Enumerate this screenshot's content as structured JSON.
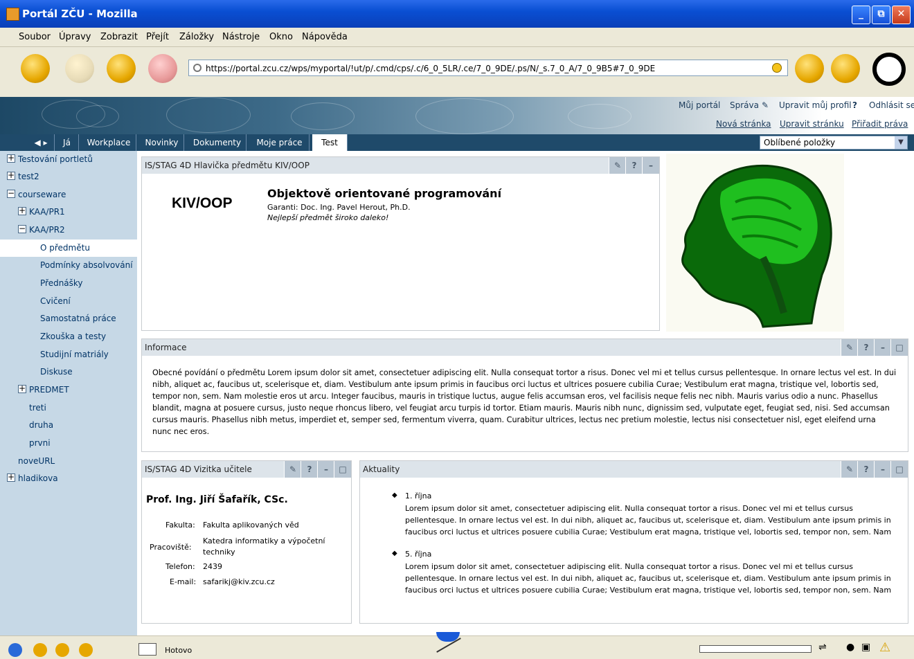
{
  "window": {
    "title": "Portál ZČU - Mozilla",
    "min": "_",
    "max": "⧉",
    "close": "✕"
  },
  "menu": [
    "Soubor",
    "Úpravy",
    "Zobrazit",
    "Přejít",
    "Záložky",
    "Nástroje",
    "Okno",
    "Nápověda"
  ],
  "address": {
    "url": "https://portal.zcu.cz/wps/myportal/!ut/p/.cmd/cps/.c/6_0_5LR/.ce/7_0_9DE/.ps/N/_s.7_0_A/7_0_9B5#7_0_9DE"
  },
  "toplinks": {
    "my_portal": "Můj portál",
    "admin": "Správa",
    "edit_profile": "Upravit můj profil",
    "help": "?",
    "logout": "Odhlásit se",
    "new_page": "Nová stránka",
    "edit_page": "Upravit stránku",
    "assign_rights": "Přiřadit práva"
  },
  "tabs": [
    "Já",
    "Workplace",
    "Novinky",
    "Dokumenty",
    "Moje práce",
    "Test"
  ],
  "favorites": "Oblíbené položky",
  "tree": [
    "Testování portletů",
    "test2",
    "courseware",
    "KAA/PR1",
    "KAA/PR2",
    "O předmětu",
    "Podmínky absolvování",
    "Přednášky",
    "Cvičení",
    "Samostatná práce",
    "Zkouška a testy",
    "Studijní matriály",
    "Diskuse",
    "PREDMET",
    "treti",
    "druha",
    "prvni",
    "noveURL",
    "hladikova"
  ],
  "header_portlet": {
    "title": "IS/STAG 4D Hlavička předmětu KIV/OOP",
    "code": "KIV/OOP",
    "name": "Objektově orientované programování",
    "guarantor": "Garanti: Doc. Ing. Pavel Herout, Ph.D.",
    "motto": "Nejlepší předmět široko daleko!"
  },
  "info_portlet": {
    "title": "Informace",
    "text": "Obecné povídání o předmětu Lorem ipsum dolor sit amet, consectetuer adipiscing elit. Nulla consequat tortor a risus. Donec vel mi et tellus cursus pellentesque. In ornare lectus vel est. In dui nibh, aliquet ac, faucibus ut, scelerisque et, diam. Vestibulum ante ipsum primis in faucibus orci luctus et ultrices posuere cubilia Curae; Vestibulum erat magna, tristique vel, lobortis sed, tempor non, sem. Nam molestie eros ut arcu. Integer faucibus, mauris in tristique luctus, augue felis accumsan eros, vel facilisis neque felis nec nibh. Mauris varius odio a nunc. Phasellus blandit, magna at posuere cursus, justo neque rhoncus libero, vel feugiat arcu turpis id tortor. Etiam mauris. Mauris nibh nunc, dignissim sed, vulputate eget, feugiat sed, nisi. Sed accumsan cursus mauris. Phasellus nibh metus, imperdiet et, semper sed, fermentum viverra, quam. Curabitur ultrices, lectus nec pretium molestie, lectus nisi consectetuer nisl, eget eleifend urna nunc nec eros."
  },
  "teacher_portlet": {
    "title": "IS/STAG 4D Vizitka učitele",
    "name": "Prof. Ing. Jiří Šafařík, CSc.",
    "faculty_label": "Fakulta:",
    "faculty": "Fakulta aplikovaných věd",
    "dept_label": "Pracoviště:",
    "dept": "Katedra informatiky a výpočetní techniky",
    "phone_label": "Telefon:",
    "phone": "2439",
    "email_label": "E-mail:",
    "email": "safarikj@kiv.zcu.cz"
  },
  "news_portlet": {
    "title": "Aktuality",
    "items": [
      {
        "date": "1. října",
        "text": "Lorem ipsum dolor sit amet, consectetuer adipiscing elit. Nulla consequat tortor a risus. Donec vel mi et tellus cursus pellentesque. In ornare lectus vel est. In dui nibh, aliquet ac, faucibus ut, scelerisque et, diam. Vestibulum ante ipsum primis in faucibus orci luctus et ultrices posuere cubilia Curae; Vestibulum erat magna, tristique vel, lobortis sed, tempor non, sem. Nam"
      },
      {
        "date": "5. října",
        "text": "Lorem ipsum dolor sit amet, consectetuer adipiscing elit. Nulla consequat tortor a risus. Donec vel mi et tellus cursus pellentesque. In ornare lectus vel est. In dui nibh, aliquet ac, faucibus ut, scelerisque et, diam. Vestibulum ante ipsum primis in faucibus orci luctus et ultrices posuere cubilia Curae; Vestibulum erat magna, tristique vel, lobortis sed, tempor non, sem. Nam"
      }
    ]
  },
  "status": {
    "text": "Hotovo"
  },
  "colors": {
    "accent": "#1f4a6a",
    "tree_bg": "#c6d8e6",
    "title_blue": "#0a4fd3"
  }
}
